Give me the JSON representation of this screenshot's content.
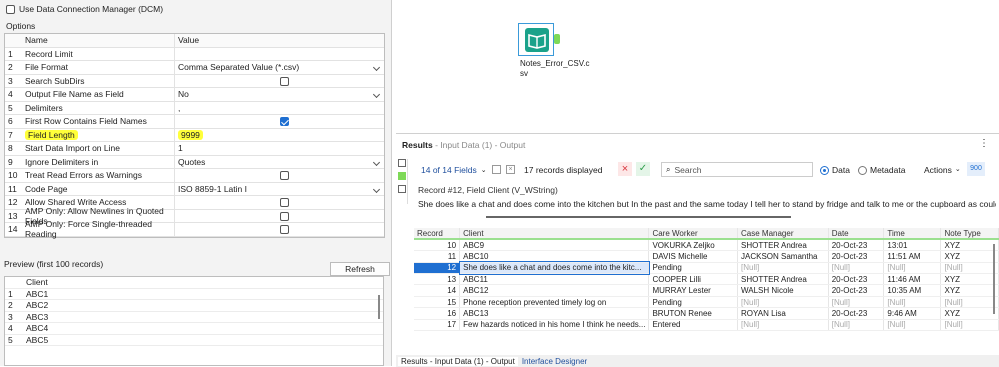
{
  "dcm": {
    "label": "Use Data Connection Manager (DCM)"
  },
  "options": {
    "title": "Options",
    "col_name": "Name",
    "col_value": "Value",
    "rows": [
      {
        "n": "1",
        "name": "Record Limit",
        "value": ""
      },
      {
        "n": "2",
        "name": "File Format",
        "value": "Comma Separated Value (*.csv)"
      },
      {
        "n": "3",
        "name": "Search SubDirs",
        "value": ""
      },
      {
        "n": "4",
        "name": "Output File Name as Field",
        "value": "No"
      },
      {
        "n": "5",
        "name": "Delimiters",
        "value": ","
      },
      {
        "n": "6",
        "name": "First Row Contains Field Names",
        "value": ""
      },
      {
        "n": "7",
        "name": "Field Length",
        "value": "9999"
      },
      {
        "n": "8",
        "name": "Start Data Import on Line",
        "value": "1"
      },
      {
        "n": "9",
        "name": "Ignore Delimiters in",
        "value": "Quotes"
      },
      {
        "n": "10",
        "name": "Treat Read Errors as Warnings",
        "value": ""
      },
      {
        "n": "11",
        "name": "Code Page",
        "value": "ISO 8859-1 Latin I"
      },
      {
        "n": "12",
        "name": "Allow Shared Write Access",
        "value": ""
      },
      {
        "n": "13",
        "name": "AMP Only: Allow Newlines in Quoted Fields",
        "value": ""
      },
      {
        "n": "14",
        "name": "AMP Only: Force Single-threaded Reading",
        "value": ""
      }
    ]
  },
  "preview": {
    "title": "Preview (first 100 records)",
    "refresh": "Refresh",
    "col": "Client",
    "rows": [
      {
        "n": "1",
        "v": "ABC1"
      },
      {
        "n": "2",
        "v": "ABC2"
      },
      {
        "n": "3",
        "v": "ABC3"
      },
      {
        "n": "4",
        "v": "ABC4"
      },
      {
        "n": "5",
        "v": "ABC5"
      }
    ]
  },
  "tool": {
    "caption1": "Notes_Error_CSV.c",
    "caption2": "sv"
  },
  "results": {
    "title": "Results",
    "subtitle": "- Input Data (1) - Output",
    "fields": "14 of 14 Fields",
    "records": "17 records displayed",
    "search": "Search",
    "data": "Data",
    "metadata": "Metadata",
    "actions": "Actions",
    "zoom": "900",
    "record_title": "Record #12, Field Client (V_WString)",
    "record_text": "She does like a chat and does come into the kitchen but In the past  and the same today I tell her to stand by fridge and talk to me or the cupboard as could get bur",
    "columns": [
      "Record",
      "Client",
      "Care Worker",
      "Case Manager",
      "Date",
      "Time",
      "Note Type"
    ],
    "rows": [
      [
        "10",
        "ABC9",
        "VOKURKA Zeljko",
        "SHOTTER Andrea",
        "20-Oct-23",
        "13:01",
        "XYZ"
      ],
      [
        "11",
        "ABC10",
        "DAVIS Michelle",
        "JACKSON Samantha",
        "20-Oct-23",
        "11:51 AM",
        "XYZ"
      ],
      [
        "12",
        "She does like a chat and does come into the kitc...",
        "Pending",
        "[Null]",
        "[Null]",
        "[Null]",
        "[Null]"
      ],
      [
        "13",
        "ABC11",
        "COOPER Lilli",
        "SHOTTER Andrea",
        "20-Oct-23",
        "11:46 AM",
        "XYZ"
      ],
      [
        "14",
        "ABC12",
        "MURRAY Lester",
        "WALSH Nicole",
        "20-Oct-23",
        "10:35 AM",
        "XYZ"
      ],
      [
        "15",
        "Phone reception prevented timely log on",
        "Pending",
        "[Null]",
        "[Null]",
        "[Null]",
        "[Null]"
      ],
      [
        "16",
        "ABC13",
        "BRUTON Renee",
        "ROYAN Lisa",
        "20-Oct-23",
        "9:46 AM",
        "XYZ"
      ],
      [
        "17",
        "Few hazards noticed in his home I think he needs...",
        "Entered",
        "[Null]",
        "[Null]",
        "[Null]",
        "[Null]"
      ]
    ],
    "tab1": "Results - Input Data (1) - Output",
    "tab2": "Interface Designer"
  },
  "colors": {
    "accent": "#1f6fd1",
    "highlight": "#ffff3a",
    "tool": "#1aa28a",
    "ok": "#2e9e4b",
    "err": "#d9363e"
  }
}
